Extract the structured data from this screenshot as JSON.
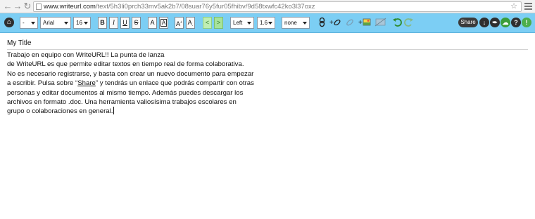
{
  "browser": {
    "url_host": "www.writeurl.com",
    "url_path": "/text/5h3li0prch33mv5ak2b7/08suar76y5fur05fhibv/9d58txwfc42ko3l37oxz"
  },
  "toolbar": {
    "heading_select": "-",
    "font_select": "Arial",
    "size_select": "16",
    "bold_label": "B",
    "italic_label": "I",
    "underline_label": "U",
    "strike_label": "S",
    "color_label": "A",
    "bgcolor_label": "A",
    "superscript_label": "A",
    "subscript_label": "A",
    "indent_less_label": "<",
    "indent_more_label": ">",
    "align_select": "Left",
    "line_height_select": "1.6",
    "list_select": "none",
    "share_label": "Share"
  },
  "document": {
    "title": "My Title",
    "lines": [
      "Trabajo en equipo con WriteURL!! La punta de lanza",
      "de WriteURL es que permite editar textos en tiempo real de forma colaborativa.",
      "No es necesario registrarse, y basta con crear un nuevo documento para empezar",
      "a escribir. Pulsa sobre “",
      "” y tendrás un enlace que podrás compartir con otras",
      "personas y editar documentos al mismo tiempo. Además puedes descargar los",
      "archivos en formato .doc. Una herramienta valiosísima trabajos escolares en",
      "grupo o colaboraciones en general."
    ],
    "link_word": "Share"
  }
}
